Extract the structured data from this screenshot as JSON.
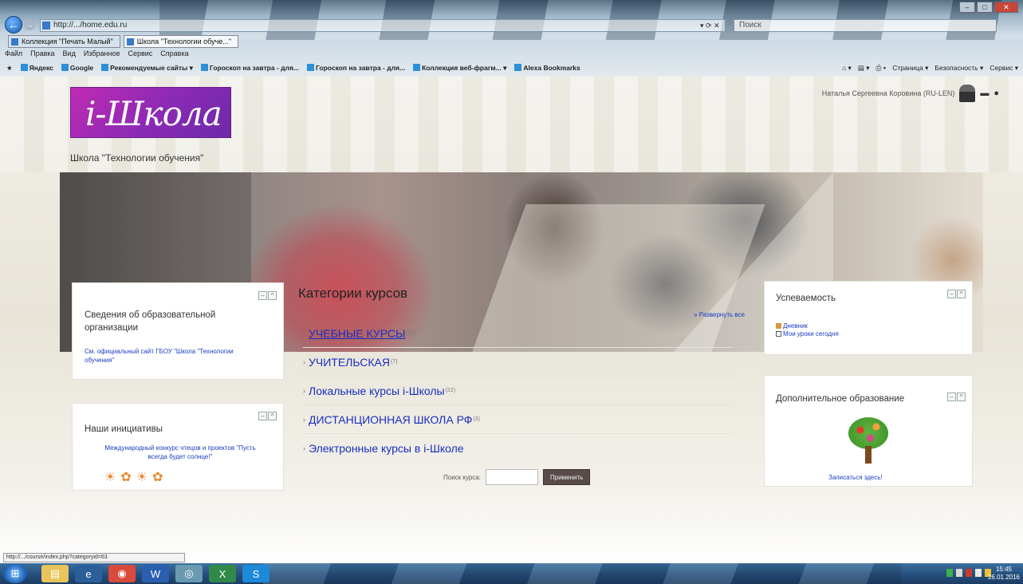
{
  "browser": {
    "address": "http://.../home.edu.ru",
    "search_placeholder": "Поиск",
    "tabs": [
      {
        "label": "Коллекция \"Печать Малый\""
      },
      {
        "label": "Школа \"Технологии обуче...\""
      }
    ],
    "menu": [
      "Файл",
      "Правка",
      "Вид",
      "Избранное",
      "Сервис",
      "Справка"
    ],
    "favorites": [
      {
        "label": "Яндекс"
      },
      {
        "label": "Google"
      },
      {
        "label": "Рекомендуемые сайты ▾"
      },
      {
        "label": "Гороскоп на завтра - для..."
      },
      {
        "label": "Гороскоп на завтра - для..."
      },
      {
        "label": "Коллекция веб-фрагм... ▾"
      },
      {
        "label": "Alexa Bookmarks"
      }
    ],
    "commands": [
      "Страница ▾",
      "Безопасность ▾",
      "Сервис ▾"
    ],
    "status_url": "http://.../course/index.php?categoryid=63"
  },
  "header": {
    "user_name": "Наталья Сергеевна Коровина (RU-LEN)",
    "logo_text": "i-Школа",
    "school_name": "Школа \"Технологии обучения\""
  },
  "left": {
    "info_title": "Сведения об образовательной организации",
    "info_link": "См. официальный сайт ГБОУ \"Школа \"Технологии обучения\"",
    "init_title": "Наши инициативы",
    "init_link": "Международный конкурс чтецов и проектов \"Пусть всегда будет солнце!\""
  },
  "center": {
    "title": "Категории курсов",
    "expand_all": "» Развернуть все",
    "categories": [
      {
        "name": "УЧЕБНЫЕ КУРСЫ",
        "count": "(11)"
      },
      {
        "name": "УЧИТЕЛЬСКАЯ",
        "count": "(7)"
      },
      {
        "name": "Локальные курсы i-Школы",
        "count": "(22)"
      },
      {
        "name": "ДИСТАНЦИОННАЯ ШКОЛА РФ",
        "count": "(3)"
      },
      {
        "name": "Электронные курсы в i-Школе",
        "count": ""
      }
    ],
    "search_label": "Поиск курса:",
    "apply": "Применить"
  },
  "right": {
    "perf_title": "Успеваемость",
    "perf_links": [
      "Дневник",
      "Мои уроки сегодня"
    ],
    "extra_title": "Дополнительное образование",
    "extra_link": "Записаться здесь!"
  },
  "taskbar": {
    "clock_time": "15:45",
    "clock_date": "26.01.2016"
  }
}
